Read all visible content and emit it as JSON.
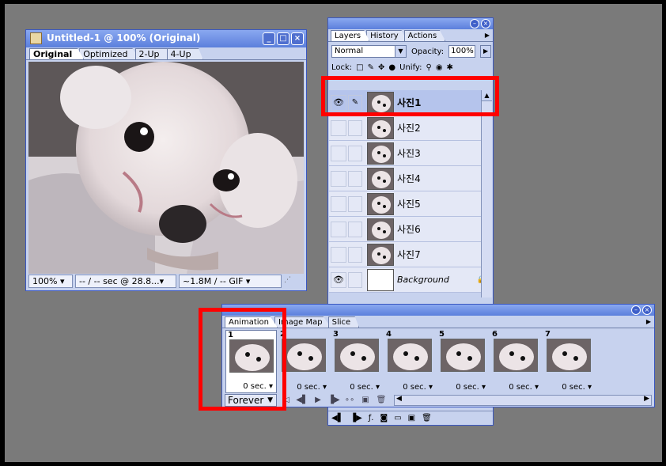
{
  "document_window": {
    "title": "Untitled-1 @ 100% (Original)",
    "tabs": [
      "Original",
      "Optimized",
      "2-Up",
      "4-Up"
    ],
    "active_tab": "Original",
    "status": {
      "zoom": "100%",
      "time": "-- / -- sec @ 28.8...",
      "size": "~1.8M / -- GIF"
    }
  },
  "layers_palette": {
    "tabs": [
      "Layers",
      "History",
      "Actions"
    ],
    "active_tab": "Layers",
    "blend_mode": "Normal",
    "opacity_label": "Opacity:",
    "opacity_value": "100%",
    "lock_label": "Lock:",
    "unify_label": "Unify:",
    "layers": [
      {
        "name": "사진1",
        "visible": true,
        "selected": true
      },
      {
        "name": "사진2",
        "visible": false,
        "selected": false
      },
      {
        "name": "사진3",
        "visible": false,
        "selected": false
      },
      {
        "name": "사진4",
        "visible": false,
        "selected": false
      },
      {
        "name": "사진5",
        "visible": false,
        "selected": false
      },
      {
        "name": "사진6",
        "visible": false,
        "selected": false
      },
      {
        "name": "사진7",
        "visible": false,
        "selected": false
      },
      {
        "name": "Background",
        "visible": true,
        "selected": false,
        "locked": true
      }
    ]
  },
  "animation_palette": {
    "tabs": [
      "Animation",
      "Image Map",
      "Slice"
    ],
    "active_tab": "Animation",
    "frames": [
      {
        "number": "1",
        "delay": "0 sec."
      },
      {
        "number": "2",
        "delay": "0 sec."
      },
      {
        "number": "3",
        "delay": "0 sec."
      },
      {
        "number": "4",
        "delay": "0 sec."
      },
      {
        "number": "5",
        "delay": "0 sec."
      },
      {
        "number": "6",
        "delay": "0 sec."
      },
      {
        "number": "7",
        "delay": "0 sec."
      }
    ],
    "loop": "Forever"
  },
  "colors": {
    "highlight": "#ff0000",
    "titlebar": "#5b7fdc",
    "panel": "#c7d2ee"
  }
}
